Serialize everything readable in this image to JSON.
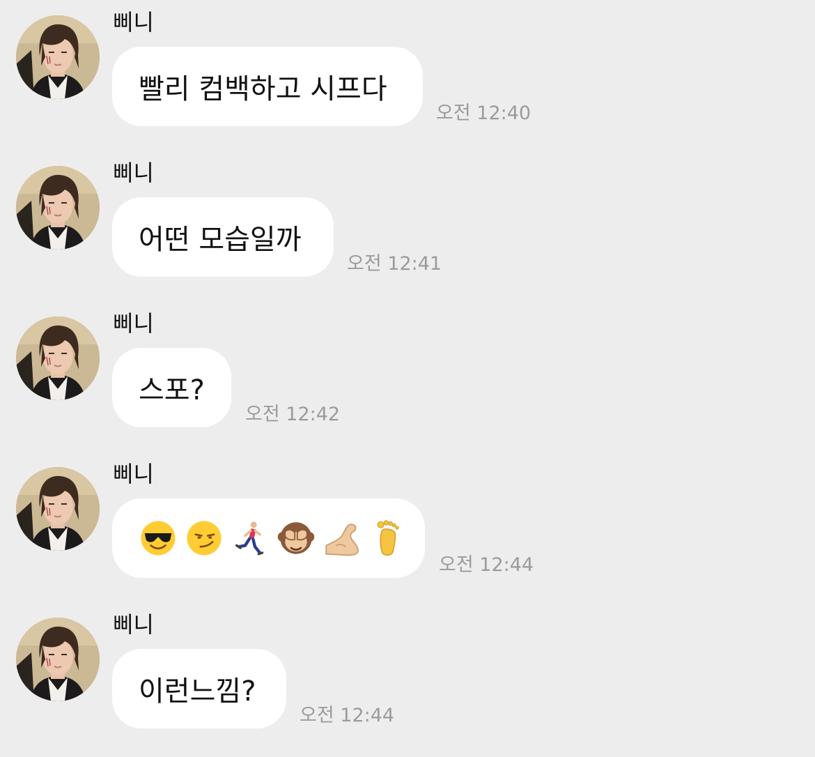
{
  "chat": {
    "messages": [
      {
        "sender": "삐니",
        "text": "빨리 컴백하고 시프다",
        "time": "오전 12:40"
      },
      {
        "sender": "삐니",
        "text": "어떤 모습일까",
        "time": "오전 12:41"
      },
      {
        "sender": "삐니",
        "text": "스포?",
        "time": "오전 12:42"
      },
      {
        "sender": "삐니",
        "emojis": [
          "smiling-face-with-sunglasses",
          "smirking-face",
          "running-man",
          "see-no-evil-monkey",
          "flexed-biceps",
          "foot"
        ],
        "time": "오전 12:44"
      },
      {
        "sender": "삐니",
        "text": "이런느낌?",
        "time": "오전 12:44"
      }
    ]
  },
  "colors": {
    "background": "#ededed",
    "bubble": "#ffffff",
    "timestamp": "#9b9b9b",
    "text": "#111111"
  }
}
